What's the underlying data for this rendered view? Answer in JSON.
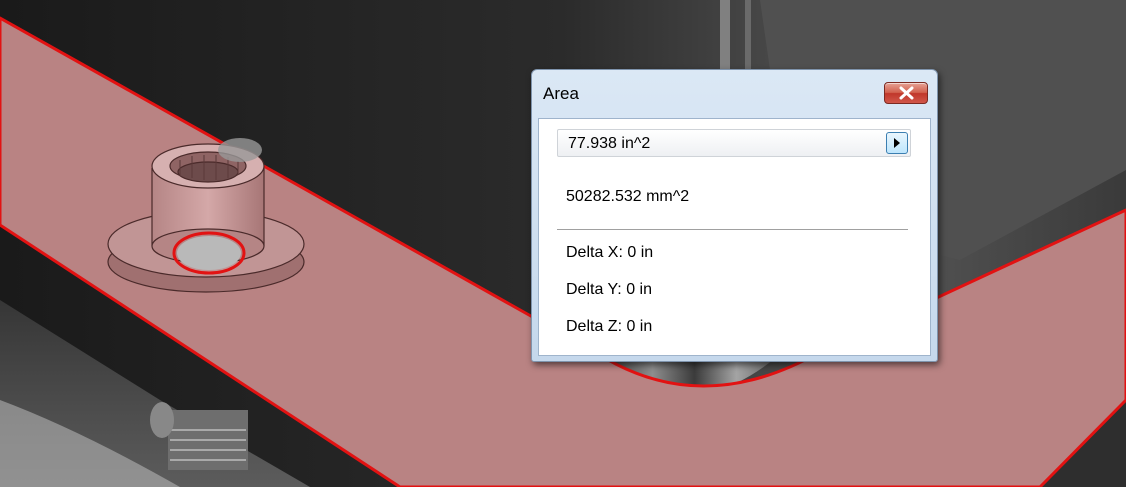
{
  "dialog": {
    "title": "Area",
    "close_icon": "close-icon",
    "primary_value": "77.938 in^2",
    "expand_icon": "play-icon",
    "secondary_value": "50282.532 mm^2",
    "delta_x": "Delta X: 0 in",
    "delta_y": "Delta Y: 0 in",
    "delta_z": "Delta Z: 0 in"
  },
  "colors": {
    "selected_face": "#b98383",
    "highlight_edge": "#e21212",
    "close_button": "#c0372a",
    "background_model": "#2a2a2a"
  }
}
